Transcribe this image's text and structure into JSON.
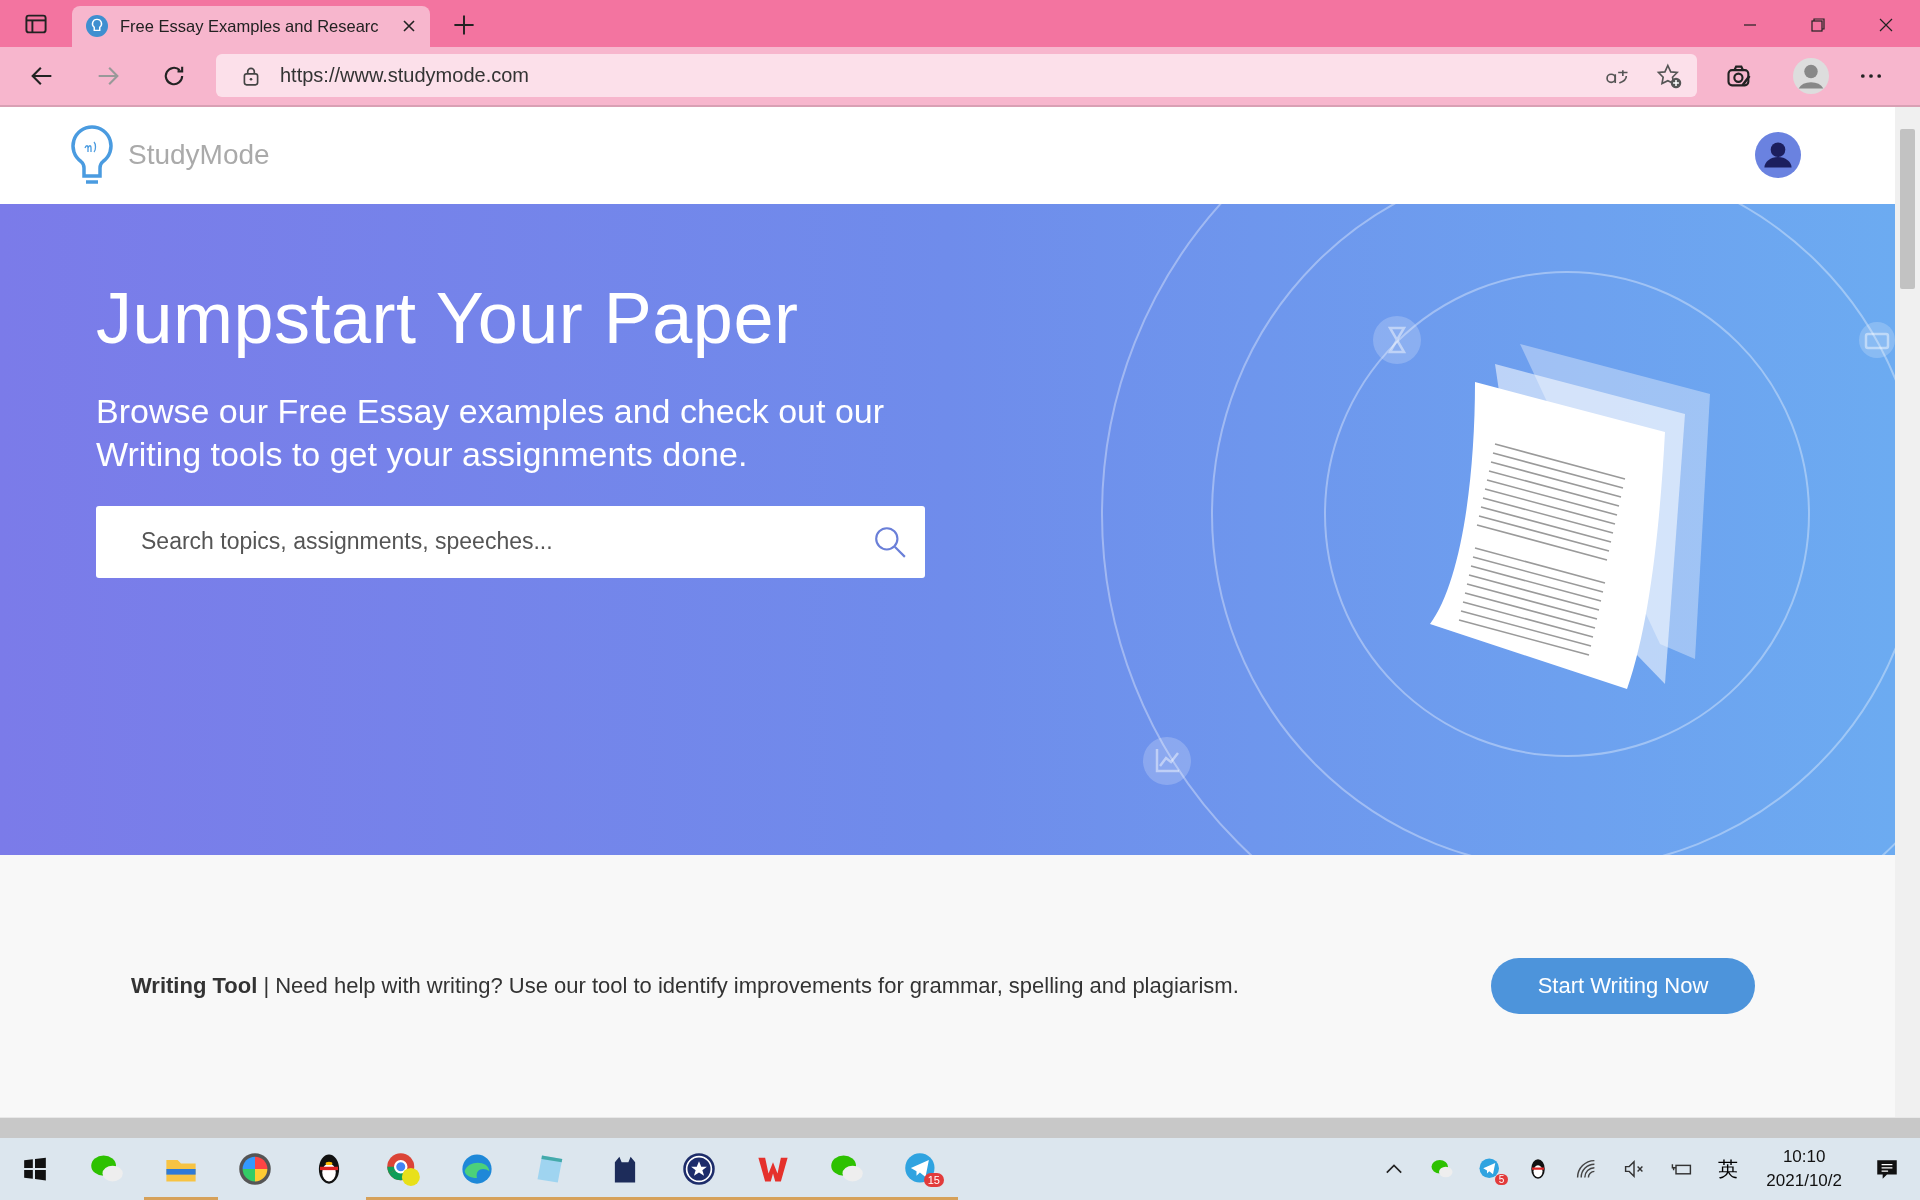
{
  "browser": {
    "tab": {
      "title": "Free Essay Examples and Researc"
    },
    "url": "https://www.studymode.com"
  },
  "header": {
    "logo_text": "StudyMode"
  },
  "hero": {
    "title": "Jumpstart Your Paper",
    "subtitle": "Browse our Free Essay examples and check out our Writing tools to get your assignments done.",
    "search": {
      "placeholder": "Search topics, assignments, speeches..."
    }
  },
  "writing_tool": {
    "text": "**Writing Tool** | Need help with writing? Use our tool to identify improvements for grammar, spelling and plagiarism.",
    "button": "Start Writing Now"
  },
  "taskbar": {
    "apps": [
      {
        "kind": "chat",
        "running": false
      },
      {
        "kind": "folder",
        "running": true
      },
      {
        "kind": "wheel",
        "running": false
      },
      {
        "kind": "penguin",
        "running": false
      },
      {
        "kind": "chrome",
        "running": true
      },
      {
        "kind": "swirl",
        "running": true
      },
      {
        "kind": "notepad",
        "running": true
      },
      {
        "kind": "cat",
        "running": true
      },
      {
        "kind": "shield",
        "running": true
      },
      {
        "kind": "zigzag",
        "running": true
      },
      {
        "kind": "chat",
        "running": true
      },
      {
        "kind": "plane",
        "running": true,
        "badge": "15"
      }
    ],
    "tray": {
      "items": [
        {
          "kind": "chat"
        },
        {
          "kind": "plane",
          "badge": "5"
        },
        {
          "kind": "penguin"
        }
      ],
      "language": "英",
      "time": "10:10",
      "date": "2021/10/2"
    }
  }
}
